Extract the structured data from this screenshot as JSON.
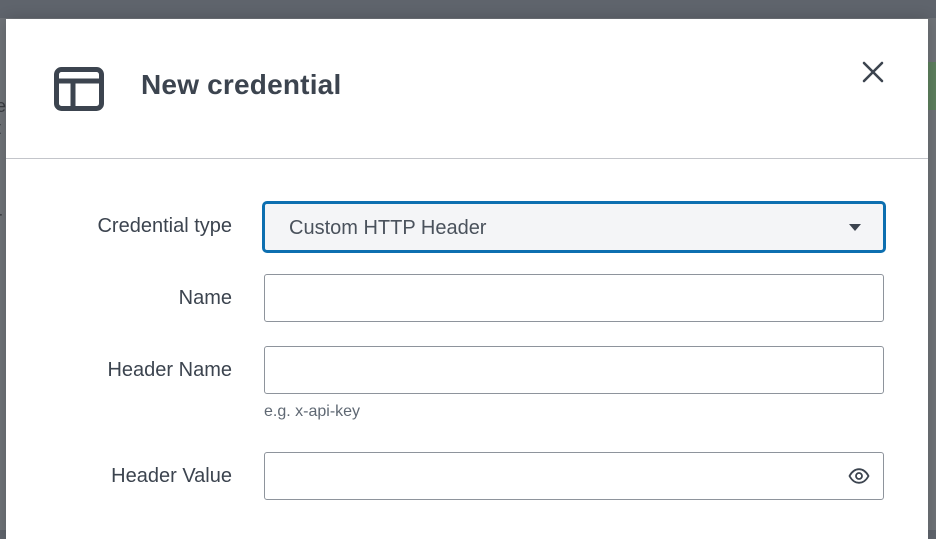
{
  "modal": {
    "title": "New credential",
    "header_icon": "layout-icon",
    "close_icon": "close-icon"
  },
  "form": {
    "credential_type": {
      "label": "Credential type",
      "selected": "Custom HTTP Header"
    },
    "name": {
      "label": "Name",
      "value": "",
      "placeholder": ""
    },
    "header_name": {
      "label": "Header Name",
      "value": "",
      "placeholder": "",
      "hint": "e.g. x-api-key"
    },
    "header_value": {
      "label": "Header Value",
      "value": "",
      "placeholder": "",
      "toggle_icon": "eye-icon"
    }
  },
  "colors": {
    "accent": "#0d6fb0",
    "text": "#3c444f",
    "muted": "#5f6873",
    "overlay": "#5f646c"
  }
}
